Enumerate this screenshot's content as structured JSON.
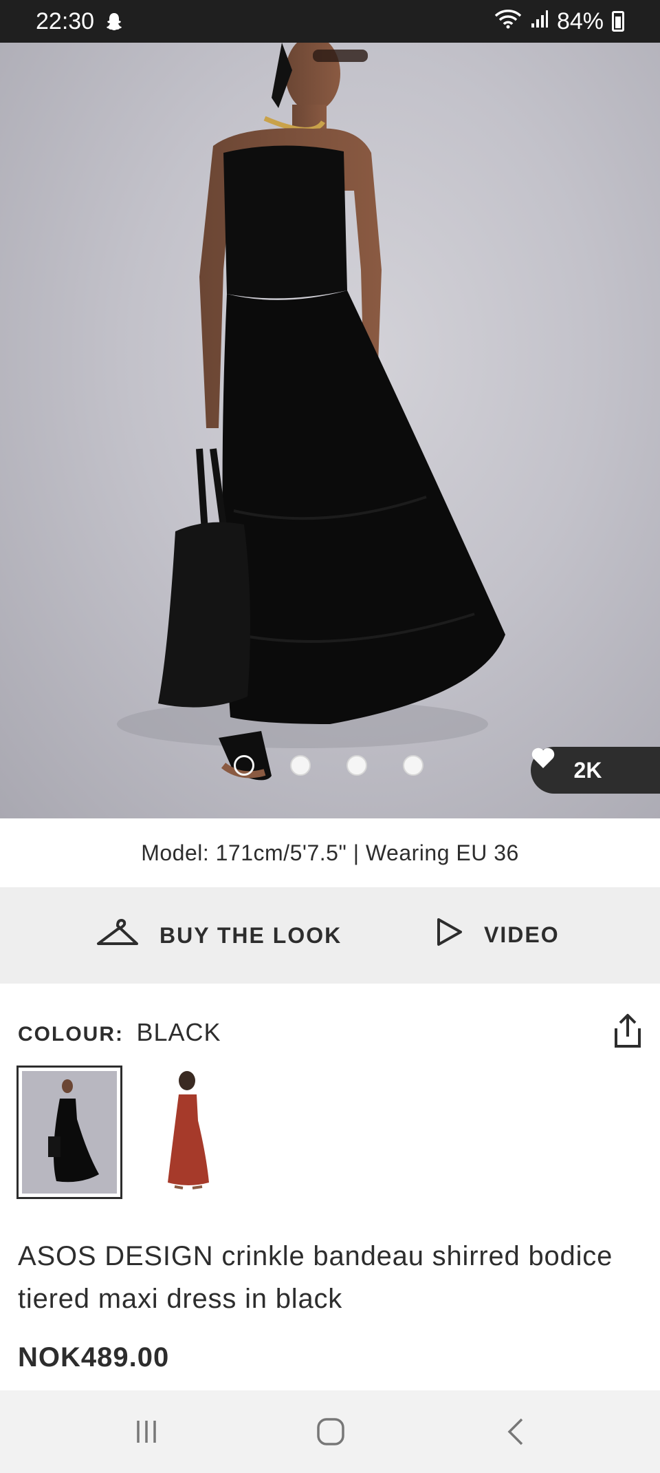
{
  "status_bar": {
    "time": "22:30",
    "battery": "84%",
    "icons": [
      "snapchat-icon",
      "wifi-icon",
      "signal-icon",
      "battery-icon"
    ]
  },
  "gallery": {
    "slide_count": 4,
    "active_index": 0,
    "likes": "2K",
    "like_icon": "heart-icon"
  },
  "model_info": "Model: 171cm/5'7.5\" | Wearing EU 36",
  "actions": {
    "buy_the_look": "BUY THE LOOK",
    "video": "VIDEO"
  },
  "colour": {
    "label": "COLOUR:",
    "value": "BLACK",
    "options": [
      "black",
      "rust-red"
    ],
    "selected": 0
  },
  "product": {
    "title": "ASOS DESIGN crinkle bandeau shirred bodice tiered maxi dress in black",
    "price": "NOK489.00"
  },
  "colors": {
    "ink": "#2d2d2d",
    "action_bar": "#eeeeee",
    "status_bar": "#1f1f1f"
  }
}
